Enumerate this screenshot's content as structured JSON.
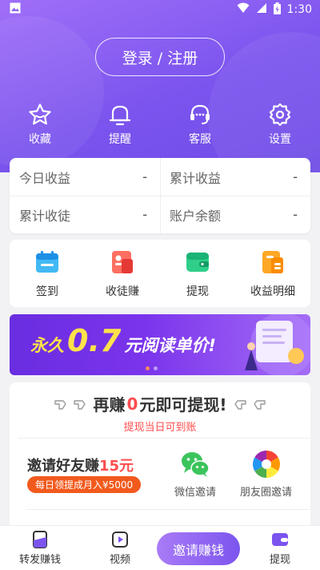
{
  "status_bar": {
    "time": "1:30"
  },
  "header": {
    "login_label": "登录 / 注册"
  },
  "top_actions": [
    {
      "label": "收藏",
      "icon": "star-icon"
    },
    {
      "label": "提醒",
      "icon": "bell-icon"
    },
    {
      "label": "客服",
      "icon": "headset-icon"
    },
    {
      "label": "设置",
      "icon": "gear-icon"
    }
  ],
  "stats": [
    {
      "label": "今日收益",
      "value": "-"
    },
    {
      "label": "累计收益",
      "value": "-"
    },
    {
      "label": "累计收徒",
      "value": "-"
    },
    {
      "label": "账户余额",
      "value": "-"
    }
  ],
  "quick_actions": [
    {
      "label": "签到",
      "icon": "calendar-icon"
    },
    {
      "label": "收徒赚",
      "icon": "apprentice-icon"
    },
    {
      "label": "提现",
      "icon": "wallet-icon"
    },
    {
      "label": "收益明细",
      "icon": "ledger-icon"
    }
  ],
  "banner": {
    "prefix": "永久",
    "number": "0.7",
    "suffix": "元阅读单价!"
  },
  "withdraw_card": {
    "title_prefix": "再赚",
    "amount": "0",
    "title_suffix": "元即可提现!",
    "subtitle": "提现当日可到账"
  },
  "invite": {
    "title_prefix": "邀请好友赚",
    "amount": "15元",
    "badge": "每日领提成月入¥5000",
    "wechat_label": "微信邀请",
    "moments_label": "朋友圈邀请"
  },
  "tabbar": {
    "tabs": [
      {
        "label": "转发赚钱",
        "icon": "share-doc-icon"
      },
      {
        "label": "视频",
        "icon": "video-play-icon"
      },
      {
        "label": "提现",
        "icon": "withdraw-wallet-icon"
      }
    ],
    "invite_button": "邀请赚钱"
  },
  "colors": {
    "accent": "#7b54ee",
    "highlight": "#ff4d4f",
    "badge": "#f25a1d"
  }
}
